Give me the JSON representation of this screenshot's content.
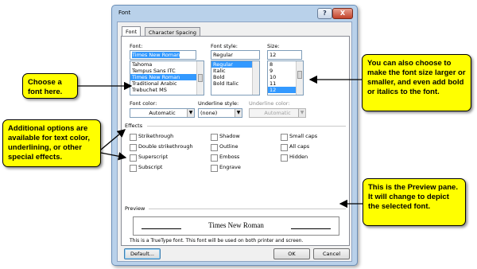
{
  "dialog": {
    "title": "Font",
    "help_glyph": "?",
    "close_glyph": "X"
  },
  "tabs": [
    {
      "label": "Font"
    },
    {
      "label": "Character Spacing"
    }
  ],
  "font": {
    "label": "Font:",
    "value": "Times New Roman",
    "items": [
      "Tahoma",
      "Tempus Sans ITC",
      "Times New Roman",
      "Traditional Arabic",
      "Trebuchet MS"
    ],
    "selected": "Times New Roman"
  },
  "font_style": {
    "label": "Font style:",
    "value": "Regular",
    "items": [
      "Regular",
      "Italic",
      "Bold",
      "Bold Italic"
    ],
    "selected": "Regular"
  },
  "size": {
    "label": "Size:",
    "value": "12",
    "items": [
      "8",
      "9",
      "10",
      "11",
      "12"
    ],
    "selected": "12"
  },
  "font_color": {
    "label": "Font color:",
    "value": "Automatic"
  },
  "underline_style": {
    "label": "Underline style:",
    "value": "(none)"
  },
  "underline_color": {
    "label": "Underline color:",
    "value": "Automatic"
  },
  "effects": {
    "label": "Effects",
    "col1": [
      "Strikethrough",
      "Double strikethrough",
      "Superscript",
      "Subscript"
    ],
    "col2": [
      "Shadow",
      "Outline",
      "Emboss",
      "Engrave"
    ],
    "col3": [
      "Small caps",
      "All caps",
      "Hidden"
    ]
  },
  "preview": {
    "label": "Preview",
    "sample": "Times New Roman",
    "note": "This is a TrueType font. This font will be used on both printer and screen."
  },
  "buttons": {
    "default": "Default...",
    "ok": "OK",
    "cancel": "Cancel"
  },
  "callouts": {
    "choose_font": "Choose a font here.",
    "additional": "Additional options are available for text color, underlining, or other special effects.",
    "size_style": "You can also choose to make the font size larger or smaller, and even add bold or italics to the font.",
    "preview": "This is the Preview pane.  It will change to depict the selected font."
  },
  "colors": {
    "callout_fill": "#ffff00",
    "selection": "#3399ff",
    "window_frame": "#b9d1ea"
  }
}
